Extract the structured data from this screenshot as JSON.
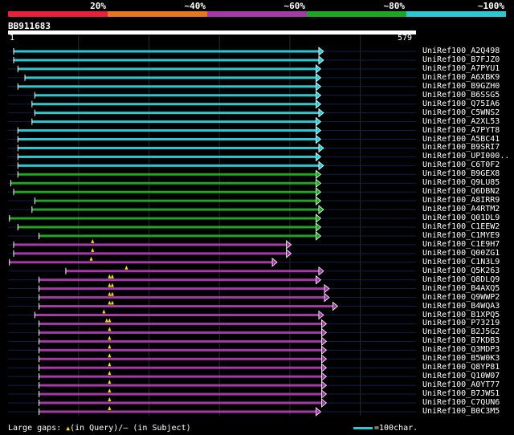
{
  "legend": {
    "segments": [
      {
        "label": "20%",
        "color": "#e8213a"
      },
      {
        "label": "~40%",
        "color": "#e77620"
      },
      {
        "label": "~60%",
        "color": "#a33ba6"
      },
      {
        "label": "~80%",
        "color": "#1ea524"
      },
      {
        "label": "~100%",
        "color": "#2cc7d0"
      }
    ]
  },
  "query": {
    "name": "BB911683",
    "start": "1",
    "end": "579"
  },
  "hits": [
    {
      "id": "UniRef100_A2Q498",
      "color": "#2cc7d0",
      "start": 8,
      "end": 441,
      "gaps": []
    },
    {
      "id": "UniRef100_B7FJZ0",
      "color": "#2cc7d0",
      "start": 8,
      "end": 441,
      "gaps": []
    },
    {
      "id": "UniRef100_A7PYU1",
      "color": "#2cc7d0",
      "start": 14,
      "end": 437,
      "gaps": []
    },
    {
      "id": "UniRef100_A6XBK9",
      "color": "#2cc7d0",
      "start": 24,
      "end": 437,
      "gaps": []
    },
    {
      "id": "UniRef100_B9GZH0",
      "color": "#2cc7d0",
      "start": 14,
      "end": 437,
      "gaps": []
    },
    {
      "id": "UniRef100_B6SSG5",
      "color": "#2cc7d0",
      "start": 38,
      "end": 437,
      "gaps": []
    },
    {
      "id": "UniRef100_Q75IA6",
      "color": "#2cc7d0",
      "start": 34,
      "end": 437,
      "gaps": []
    },
    {
      "id": "UniRef100_C5WNS2",
      "color": "#2cc7d0",
      "start": 38,
      "end": 441,
      "gaps": []
    },
    {
      "id": "UniRef100_A2XL53",
      "color": "#2cc7d0",
      "start": 34,
      "end": 437,
      "gaps": []
    },
    {
      "id": "UniRef100_A7PYT8",
      "color": "#2cc7d0",
      "start": 14,
      "end": 437,
      "gaps": []
    },
    {
      "id": "UniRef100_A5BC41",
      "color": "#2cc7d0",
      "start": 14,
      "end": 437,
      "gaps": []
    },
    {
      "id": "UniRef100_B9SRI7",
      "color": "#2cc7d0",
      "start": 14,
      "end": 441,
      "gaps": []
    },
    {
      "id": "UniRef100_UPI000..",
      "color": "#2cc7d0",
      "start": 14,
      "end": 437,
      "gaps": []
    },
    {
      "id": "UniRef100_C6T0F2",
      "color": "#2cc7d0",
      "start": 14,
      "end": 441,
      "gaps": []
    },
    {
      "id": "UniRef100_B9GEX8",
      "color": "#1ea524",
      "start": 14,
      "end": 437,
      "gaps": []
    },
    {
      "id": "UniRef100_Q9LU85",
      "color": "#1ea524",
      "start": 4,
      "end": 437,
      "gaps": []
    },
    {
      "id": "UniRef100_Q6DBN2",
      "color": "#1ea524",
      "start": 8,
      "end": 437,
      "gaps": []
    },
    {
      "id": "UniRef100_A8IRR9",
      "color": "#1ea524",
      "start": 38,
      "end": 437,
      "gaps": []
    },
    {
      "id": "UniRef100_A4RTM2",
      "color": "#1ea524",
      "start": 34,
      "end": 441,
      "gaps": []
    },
    {
      "id": "UniRef100_Q01DL9",
      "color": "#1ea524",
      "start": 2,
      "end": 437,
      "gaps": []
    },
    {
      "id": "UniRef100_C1EEW2",
      "color": "#1ea524",
      "start": 14,
      "end": 437,
      "gaps": []
    },
    {
      "id": "UniRef100_C1MYE9",
      "color": "#1ea524",
      "start": 44,
      "end": 437,
      "gaps": []
    },
    {
      "id": "UniRef100_C1E9H7",
      "color": "#a33ba6",
      "start": 8,
      "end": 395,
      "gaps": [
        120
      ]
    },
    {
      "id": "UniRef100_Q00ZG1",
      "color": "#a33ba6",
      "start": 8,
      "end": 395,
      "gaps": [
        120
      ]
    },
    {
      "id": "UniRef100_C1N3L9",
      "color": "#a33ba6",
      "start": 2,
      "end": 375,
      "gaps": [
        118
      ]
    },
    {
      "id": "UniRef100_Q5K263",
      "color": "#a33ba6",
      "start": 82,
      "end": 441,
      "gaps": [
        168
      ]
    },
    {
      "id": "UniRef100_Q8DLQ9",
      "color": "#a33ba6",
      "start": 44,
      "end": 437,
      "gaps": [
        144,
        148
      ]
    },
    {
      "id": "UniRef100_B4AXQ5",
      "color": "#a33ba6",
      "start": 44,
      "end": 449,
      "gaps": [
        144,
        148
      ]
    },
    {
      "id": "UniRef100_Q9WWP2",
      "color": "#a33ba6",
      "start": 44,
      "end": 449,
      "gaps": [
        144,
        148
      ]
    },
    {
      "id": "UniRef100_B4WQA3",
      "color": "#a33ba6",
      "start": 44,
      "end": 461,
      "gaps": [
        144,
        148
      ]
    },
    {
      "id": "UniRef100_B1XPQ5",
      "color": "#a33ba6",
      "start": 38,
      "end": 441,
      "gaps": [
        136
      ]
    },
    {
      "id": "UniRef100_P73219",
      "color": "#a33ba6",
      "start": 44,
      "end": 445,
      "gaps": [
        140,
        144
      ]
    },
    {
      "id": "UniRef100_B2J5G2",
      "color": "#a33ba6",
      "start": 44,
      "end": 445,
      "gaps": [
        144
      ]
    },
    {
      "id": "UniRef100_B7KDB3",
      "color": "#a33ba6",
      "start": 44,
      "end": 445,
      "gaps": [
        144
      ]
    },
    {
      "id": "UniRef100_Q3MDP3",
      "color": "#a33ba6",
      "start": 44,
      "end": 445,
      "gaps": [
        144
      ]
    },
    {
      "id": "UniRef100_B5W0K3",
      "color": "#a33ba6",
      "start": 44,
      "end": 445,
      "gaps": [
        144
      ]
    },
    {
      "id": "UniRef100_Q8YP81",
      "color": "#a33ba6",
      "start": 44,
      "end": 445,
      "gaps": [
        144
      ]
    },
    {
      "id": "UniRef100_Q10W07",
      "color": "#a33ba6",
      "start": 44,
      "end": 445,
      "gaps": [
        144
      ]
    },
    {
      "id": "UniRef100_A0YT77",
      "color": "#a33ba6",
      "start": 44,
      "end": 445,
      "gaps": [
        144
      ]
    },
    {
      "id": "UniRef100_B7JWS1",
      "color": "#a33ba6",
      "start": 44,
      "end": 445,
      "gaps": [
        144
      ]
    },
    {
      "id": "UniRef100_C7QUN6",
      "color": "#a33ba6",
      "start": 44,
      "end": 445,
      "gaps": [
        144
      ]
    },
    {
      "id": "UniRef100_B0C3M5",
      "color": "#a33ba6",
      "start": 44,
      "end": 437,
      "gaps": [
        144
      ]
    }
  ],
  "footer": {
    "large_gaps_label": "Large gaps: ",
    "in_query": "(in Query)/",
    "dash": "—",
    "in_subject": " (in Subject)",
    "scale_label": "=100char."
  }
}
